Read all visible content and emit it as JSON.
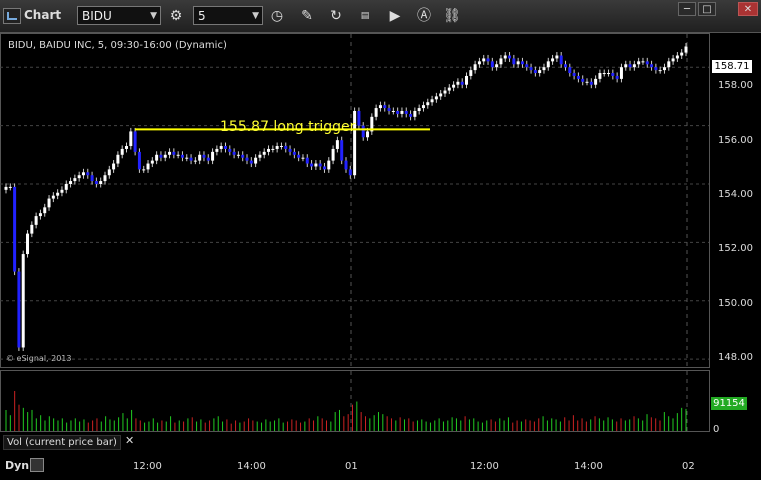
{
  "window": {
    "title": "Chart"
  },
  "toolbar": {
    "symbol": "BIDU",
    "interval": "5",
    "controls": [
      "minimize",
      "maximize",
      "close"
    ]
  },
  "chart_header": {
    "label": "BIDU, BAIDU INC, 5, 09:30-16:00 (Dynamic)"
  },
  "copyright": "© eSignal, 2013",
  "annotation": {
    "text": "155.87 long trigger",
    "line_price": 155.87,
    "color": "#ffff00"
  },
  "price_axis": {
    "ticks": [
      "158.00",
      "156.00",
      "154.00",
      "152.00",
      "150.00",
      "148.00"
    ],
    "last_price": "158.71"
  },
  "volume_pane": {
    "label": "Vol (current price bar)",
    "current_value": "91154",
    "zero_label": "0"
  },
  "time_axis": {
    "ticks": [
      "12:00",
      "14:00",
      "01",
      "12:00",
      "14:00",
      "02"
    ]
  },
  "footer": {
    "mode": "Dyn"
  },
  "colors": {
    "up": "#ffffff",
    "down": "#2222ff",
    "vol_up": "#22cc22",
    "vol_down": "#cc2222",
    "grid": "#444444"
  },
  "chart_data": {
    "type": "candlestick",
    "ylim": [
      147.8,
      159.0
    ],
    "session_dividers": [
      "01",
      "02"
    ],
    "closes": [
      153.9,
      153.9,
      151.0,
      148.4,
      151.6,
      152.3,
      152.6,
      152.9,
      153.0,
      153.2,
      153.5,
      153.6,
      153.7,
      153.8,
      154.0,
      154.1,
      154.2,
      154.3,
      154.4,
      154.3,
      154.1,
      154.0,
      154.1,
      154.3,
      154.5,
      154.7,
      155.0,
      155.2,
      155.3,
      155.8,
      155.1,
      154.5,
      154.5,
      154.7,
      154.8,
      155.0,
      154.9,
      155.0,
      155.1,
      155.0,
      155.0,
      154.9,
      154.9,
      154.8,
      154.8,
      155.0,
      154.9,
      154.8,
      155.1,
      155.2,
      155.3,
      155.2,
      155.1,
      155.0,
      155.0,
      154.9,
      154.8,
      154.7,
      154.9,
      155.0,
      155.1,
      155.2,
      155.2,
      155.3,
      155.3,
      155.2,
      155.1,
      155.0,
      154.9,
      154.9,
      154.7,
      154.6,
      154.7,
      154.6,
      154.5,
      154.8,
      155.2,
      155.5,
      154.8,
      154.5,
      154.3,
      156.5,
      156.0,
      155.6,
      155.8,
      156.3,
      156.6,
      156.7,
      156.6,
      156.5,
      156.5,
      156.4,
      156.5,
      156.4,
      156.3,
      156.5,
      156.6,
      156.7,
      156.8,
      156.9,
      157.0,
      157.1,
      157.2,
      157.3,
      157.4,
      157.5,
      157.4,
      157.7,
      157.9,
      158.1,
      158.2,
      158.3,
      158.2,
      158.0,
      158.1,
      158.3,
      158.4,
      158.3,
      158.1,
      158.2,
      158.1,
      158.0,
      157.9,
      157.8,
      157.9,
      158.0,
      158.2,
      158.3,
      158.4,
      158.1,
      158.0,
      157.8,
      157.7,
      157.6,
      157.5,
      157.5,
      157.4,
      157.6,
      157.8,
      157.8,
      157.8,
      157.7,
      157.6,
      158.0,
      158.1,
      158.0,
      158.1,
      158.2,
      158.2,
      158.1,
      158.0,
      157.9,
      157.9,
      158.0,
      158.2,
      158.3,
      158.4,
      158.5,
      158.71
    ],
    "volumes": [
      20,
      15,
      38,
      25,
      22,
      18,
      20,
      12,
      15,
      10,
      14,
      12,
      10,
      12,
      8,
      10,
      12,
      9,
      11,
      8,
      10,
      12,
      9,
      14,
      11,
      10,
      13,
      17,
      12,
      20,
      12,
      10,
      8,
      9,
      12,
      8,
      10,
      9,
      14,
      8,
      10,
      9,
      12,
      13,
      9,
      11,
      8,
      10,
      12,
      14,
      9,
      11,
      7,
      10,
      8,
      9,
      12,
      10,
      9,
      8,
      11,
      9,
      10,
      12,
      8,
      9,
      11,
      10,
      8,
      9,
      12,
      10,
      14,
      12,
      10,
      9,
      18,
      20,
      14,
      16,
      25,
      28,
      18,
      14,
      12,
      15,
      18,
      16,
      14,
      12,
      10,
      13,
      11,
      12,
      9,
      10,
      11,
      9,
      8,
      10,
      12,
      9,
      10,
      13,
      12,
      10,
      14,
      11,
      12,
      9,
      8,
      10,
      11,
      9,
      12,
      10,
      13,
      8,
      10,
      9,
      11,
      10,
      9,
      12,
      14,
      10,
      12,
      11,
      9,
      13,
      10,
      15,
      10,
      12,
      9,
      11,
      14,
      12,
      10,
      13,
      11,
      9,
      12,
      10,
      11,
      14,
      12,
      10,
      16,
      13,
      12,
      10,
      18,
      14,
      12,
      17,
      22,
      21
    ]
  }
}
